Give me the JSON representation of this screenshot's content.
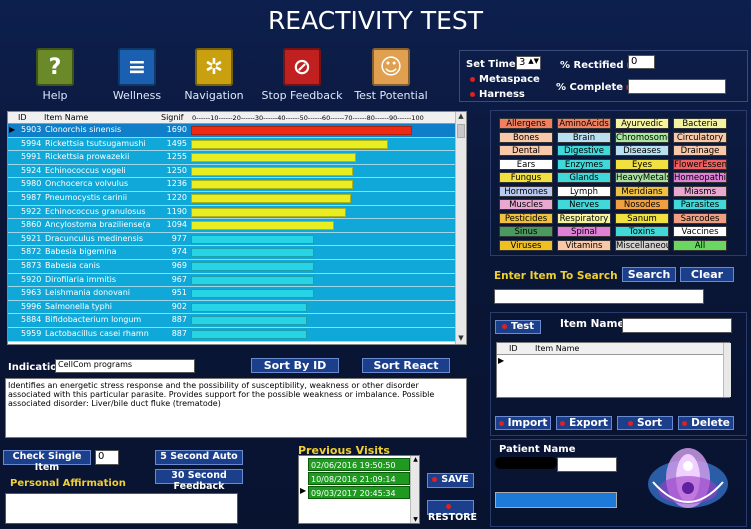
{
  "title": "REACTIVITY TEST",
  "toolbar": [
    {
      "label": "Help",
      "icon": "question-icon",
      "color": "#6a8a2a"
    },
    {
      "label": "Wellness",
      "icon": "list-icon",
      "color": "#1a5fb0"
    },
    {
      "label": "Navigation",
      "icon": "asterisk-icon",
      "color": "#c8a010"
    },
    {
      "label": "Stop Feedback",
      "icon": "stop-icon",
      "color": "#c02020"
    },
    {
      "label": "Test Potential",
      "icon": "head-icon",
      "color": "#e0a050"
    }
  ],
  "settings": {
    "set_time_label": "Set Time",
    "set_time_value": "3",
    "rectified_label": "% Rectified",
    "rectified_value": "0",
    "complete_label": "% Complete",
    "complete_value": "",
    "metaspace": "Metaspace",
    "harness": "Harness"
  },
  "grid": {
    "headers": [
      "ID",
      "Item Name",
      "Signif",
      "0------10------20------30------40------50------60------70------80------90------100"
    ],
    "rows": [
      {
        "id": "5903",
        "name": "Clonorchis sinensis",
        "signif": "1690",
        "pct": 0.9,
        "color": "#ee2a12"
      },
      {
        "id": "5994",
        "name": "Rickettsia tsutsugamushi",
        "signif": "1495",
        "pct": 0.8,
        "color": "#e8ee20"
      },
      {
        "id": "5991",
        "name": "Rickettsia prowazekii",
        "signif": "1255",
        "pct": 0.67,
        "color": "#e8ee20"
      },
      {
        "id": "5924",
        "name": "Echinococcus vogeli",
        "signif": "1250",
        "pct": 0.66,
        "color": "#e8ee20"
      },
      {
        "id": "5980",
        "name": "Onchocerca volvulus",
        "signif": "1236",
        "pct": 0.66,
        "color": "#e8ee20"
      },
      {
        "id": "5987",
        "name": "Pneumocystis carinii",
        "signif": "1220",
        "pct": 0.65,
        "color": "#e8ee20"
      },
      {
        "id": "5922",
        "name": "Echinococcus granulosus",
        "signif": "1190",
        "pct": 0.63,
        "color": "#e8ee20"
      },
      {
        "id": "5860",
        "name": "Ancylostoma braziliense(a",
        "signif": "1094",
        "pct": 0.58,
        "color": "#e8ee20"
      },
      {
        "id": "5921",
        "name": "Dracunculus medinensis",
        "signif": "977",
        "pct": 0.5,
        "color": "#27d4e6"
      },
      {
        "id": "5872",
        "name": "Babesia bigemina",
        "signif": "974",
        "pct": 0.5,
        "color": "#27d4e6"
      },
      {
        "id": "5873",
        "name": "Babesia canis",
        "signif": "969",
        "pct": 0.5,
        "color": "#27d4e6"
      },
      {
        "id": "5920",
        "name": "Dirofilaria immitis",
        "signif": "967",
        "pct": 0.5,
        "color": "#27d4e6"
      },
      {
        "id": "5963",
        "name": "Leishmania donovani",
        "signif": "951",
        "pct": 0.5,
        "color": "#27d4e6"
      },
      {
        "id": "5996",
        "name": "Salmonella typhi",
        "signif": "902",
        "pct": 0.47,
        "color": "#27d4e6"
      },
      {
        "id": "5884",
        "name": "Bifidobacterium longum",
        "signif": "887",
        "pct": 0.47,
        "color": "#27d4e6"
      },
      {
        "id": "5959",
        "name": "Lactobacillus casei rhamn",
        "signif": "887",
        "pct": 0.47,
        "color": "#27d4e6"
      }
    ]
  },
  "indication": {
    "label": "Indication",
    "value": "CellCom programs",
    "description": "Identifies an energetic stress response and the possibility of susceptibility, weakness or other disorder associated with this particular parasite. Provides support for the possible weakness or imbalance. Possible associated disorder: Liver/bile duct fluke (trematode)"
  },
  "sort": {
    "by_id": "Sort By ID",
    "react": "Sort React"
  },
  "categories": [
    {
      "label": "Allergens",
      "color": "#f08060"
    },
    {
      "label": "AminoAcids",
      "color": "#f08060"
    },
    {
      "label": "Ayurvedic",
      "color": "#f4f4a0"
    },
    {
      "label": "Bacteria",
      "color": "#f4f4a0"
    },
    {
      "label": "Bones",
      "color": "#f8c8a8"
    },
    {
      "label": "Brain",
      "color": "#b8e0f0"
    },
    {
      "label": "Chromosomes",
      "color": "#a8e8a0"
    },
    {
      "label": "Circulatory",
      "color": "#f8c8a8"
    },
    {
      "label": "Dental",
      "color": "#f8c8a8"
    },
    {
      "label": "Digestive",
      "color": "#40d8d8"
    },
    {
      "label": "Diseases",
      "color": "#b8e0f0"
    },
    {
      "label": "Drainage",
      "color": "#f8c8a8"
    },
    {
      "label": "Ears",
      "color": "#ffffff"
    },
    {
      "label": "Enzymes",
      "color": "#40d8d8"
    },
    {
      "label": "Eyes",
      "color": "#f0e040"
    },
    {
      "label": "FlowerEssence",
      "color": "#f06060"
    },
    {
      "label": "Fungus",
      "color": "#f0e040"
    },
    {
      "label": "Glands",
      "color": "#40d8d8"
    },
    {
      "label": "HeavyMetals",
      "color": "#a8e0a0"
    },
    {
      "label": "Homeopathic",
      "color": "#e080d8"
    },
    {
      "label": "Hormones",
      "color": "#b8c8f0"
    },
    {
      "label": "Lymph",
      "color": "#ffffff"
    },
    {
      "label": "Meridians",
      "color": "#f0c040"
    },
    {
      "label": "Miasms",
      "color": "#e8a8d0"
    },
    {
      "label": "Muscles",
      "color": "#e8a8d0"
    },
    {
      "label": "Nerves",
      "color": "#40d8d8"
    },
    {
      "label": "Nosodes",
      "color": "#f0a040"
    },
    {
      "label": "Parasites",
      "color": "#40d8d8"
    },
    {
      "label": "Pesticides",
      "color": "#f0c040"
    },
    {
      "label": "Respiratory",
      "color": "#f4f4a0"
    },
    {
      "label": "Sanum",
      "color": "#f0e040"
    },
    {
      "label": "Sarcodes",
      "color": "#f0a080"
    },
    {
      "label": "Sinus",
      "color": "#4a9a60"
    },
    {
      "label": "Spinal",
      "color": "#e080d8"
    },
    {
      "label": "Toxins",
      "color": "#40d8d8"
    },
    {
      "label": "Vaccines",
      "color": "#ffffff"
    },
    {
      "label": "Viruses",
      "color": "#f0c020"
    },
    {
      "label": "Vitamins",
      "color": "#f8c8a8"
    },
    {
      "label": "Miscellaneous",
      "color": "#d0d0d0"
    },
    {
      "label": "All",
      "color": "#6ad860"
    }
  ],
  "search": {
    "label": "Enter Item To Search",
    "search": "Search",
    "clear": "Clear",
    "value": ""
  },
  "test": {
    "button": "Test",
    "item_name_label": "Item Name",
    "item_name_value": "",
    "headers": [
      "ID",
      "Item Name"
    ]
  },
  "actions": [
    "Import",
    "Export",
    "Sort",
    "Delete"
  ],
  "patient": {
    "label": "Patient Name",
    "value": ""
  },
  "bottom": {
    "check_single": "Check Single Item",
    "check_value": "0",
    "five_sec": "5 Second Auto",
    "thirty_sec": "30 Second Feedback",
    "affirmation": "Personal Affirmation"
  },
  "visits": {
    "label": "Previous Visits",
    "items": [
      "02/06/2016 19:50:50",
      "10/08/2016 21:09:14",
      "09/03/2017 20:45:34"
    ],
    "save": "SAVE",
    "restore": "RESTORE"
  }
}
